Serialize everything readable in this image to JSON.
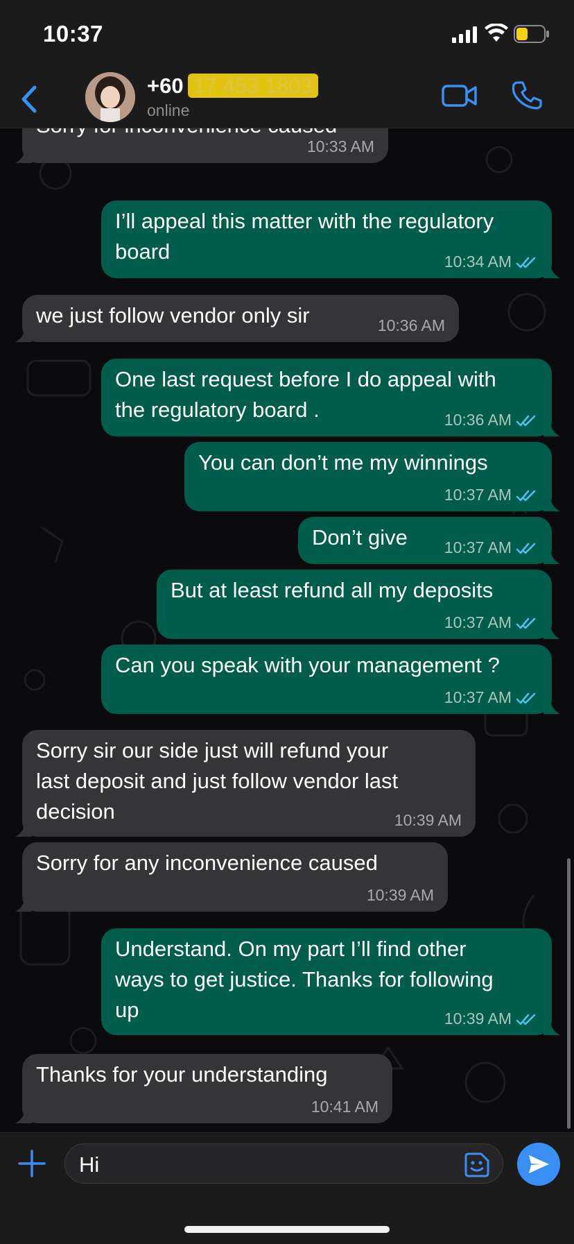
{
  "status_bar": {
    "time": "10:37"
  },
  "header": {
    "contact_prefix": "+60",
    "contact_hidden": "17 453 1803",
    "status": "online"
  },
  "messages": [
    {
      "dir": "in",
      "text": "Sorry for inconvenience caused",
      "time": "10:33 AM"
    },
    {
      "dir": "out",
      "text": "I’ll appeal this matter with the regulatory\nboard",
      "time": "10:34 AM"
    },
    {
      "dir": "in",
      "text": "we just follow vendor only sir",
      "time": "10:36 AM"
    },
    {
      "dir": "out",
      "text": "One last request before I do appeal with\nthe regulatory board .",
      "time": "10:36 AM"
    },
    {
      "dir": "out",
      "text": "You can don’t me my winnings",
      "time": "10:37 AM"
    },
    {
      "dir": "out",
      "text": "Don’t give",
      "time": "10:37 AM"
    },
    {
      "dir": "out",
      "text": "But at least refund all my deposits",
      "time": "10:37 AM"
    },
    {
      "dir": "out",
      "text": "Can you speak with your management ?",
      "time": "10:37 AM"
    },
    {
      "dir": "in",
      "text": "Sorry sir our side just will refund your\nlast deposit and just follow vendor last\ndecision",
      "time": "10:39 AM"
    },
    {
      "dir": "in",
      "text": "Sorry for any inconvenience caused",
      "time": "10:39 AM"
    },
    {
      "dir": "out",
      "text": "Understand. On my part I’ll find other\nways to get justice. Thanks for following\nup",
      "time": "10:39 AM"
    },
    {
      "dir": "in",
      "text": "Thanks for your understanding",
      "time": "10:41 AM"
    }
  ],
  "composer": {
    "value": "Hi"
  },
  "colors": {
    "incoming_bubble": "#353537",
    "outgoing_bubble": "#005c4b",
    "accent": "#3a8ff5",
    "read_ticks": "#53bdeb"
  }
}
